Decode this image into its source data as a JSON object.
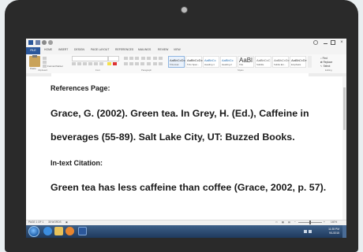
{
  "app": {
    "tabs": [
      {
        "label": "FILE"
      },
      {
        "label": "HOME"
      },
      {
        "label": "INSERT"
      },
      {
        "label": "DESIGN"
      },
      {
        "label": "PAGE LAYOUT"
      },
      {
        "label": "REFERENCES"
      },
      {
        "label": "MAILINGS"
      },
      {
        "label": "REVIEW"
      },
      {
        "label": "VIEW"
      }
    ],
    "ribbon": {
      "clipboard": {
        "paste_label": "Paste",
        "format_painter": "Format Painter",
        "group_label": "Clipboard"
      },
      "font_group_label": "Font",
      "paragraph_group_label": "Paragraph",
      "styles_group_label": "Styles",
      "editing_group_label": "Editing",
      "styles": [
        {
          "sample": "AaBbCcDc",
          "name": "¶ Normal"
        },
        {
          "sample": "AaBbCcDc",
          "name": "¶ No Spac..."
        },
        {
          "sample": "AaBbCc",
          "name": "Heading 1"
        },
        {
          "sample": "AaBbCc",
          "name": "Heading 2"
        },
        {
          "sample": "AaBl",
          "name": "Title"
        },
        {
          "sample": "AaBbCcC",
          "name": "Subtitle"
        },
        {
          "sample": "AaBbCcDc",
          "name": "Subtle Em..."
        },
        {
          "sample": "AaBbCcDc",
          "name": "Emphasis"
        }
      ],
      "editing": {
        "find": "Find",
        "replace": "Replace",
        "select": "Select"
      }
    },
    "document": {
      "heading1": "References Page:",
      "reference_line1": "Grace, G. (2002). Green tea. In Grey, H. (Ed.), Caffeine in",
      "reference_line2": "beverages (55-89). Salt Lake City, UT: Buzzed Books.",
      "heading2": "In-text Citation:",
      "citation": "Green tea has less caffeine than coffee (Grace, 2002, p. 57)."
    },
    "status": {
      "page": "PAGE 1 OF 1",
      "words": "35 WORDS",
      "zoom": "140%"
    },
    "taskbar": {
      "time": "11:35 PM",
      "date": "9/1/2015"
    },
    "colors": {
      "accent": "#2b579a",
      "taskbar": "#2a4a72"
    }
  }
}
